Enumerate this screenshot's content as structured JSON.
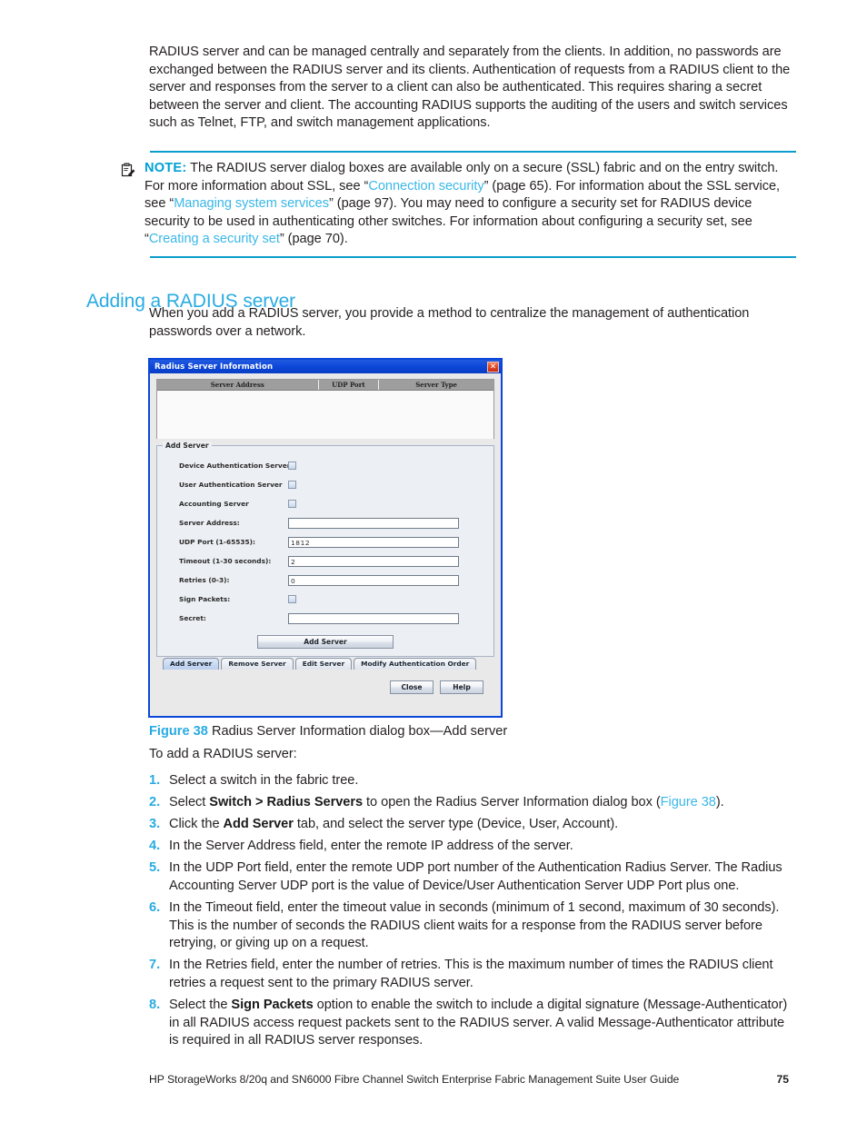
{
  "intro": {
    "paragraph": "RADIUS server and can be managed centrally and separately from the clients. In addition, no passwords are exchanged between the RADIUS server and its clients. Authentication of requests from a RADIUS client to the server and responses from the server to a client can also be authenticated. This requires sharing a secret between the server and client. The accounting RADIUS supports the auditing of the users and switch services such as Telnet, FTP, and switch management applications."
  },
  "note": {
    "icon": "note-clipboard-pencil-icon",
    "label": "NOTE:",
    "text_1": "The RADIUS server dialog boxes are available only on a secure (SSL) fabric and on the entry switch. For more information about SSL, see “",
    "link_1": "Connection security",
    "text_2": "” (page 65). For information about the SSL service, see “",
    "link_2": "Managing system services",
    "text_3": "” (page 97). You may need to configure a security set for RADIUS device security to be used in authenticating other switches. For information about configuring a security set, see “",
    "link_3": "Creating a security set",
    "text_4": "” (page 70)."
  },
  "section": {
    "heading": "Adding a RADIUS server",
    "intro": "When you add a RADIUS server, you provide a method to centralize the management of authentication passwords over a network."
  },
  "dialog": {
    "title": "Radius Server Information",
    "close_label": "✕",
    "table": {
      "headers": [
        "Server  Address",
        "UDP  Port",
        "Server  Type"
      ],
      "rows": []
    },
    "group": {
      "legend": "Add Server",
      "fields": [
        {
          "label": "Device Authentication Server",
          "type": "checkbox",
          "value": "",
          "checked": false
        },
        {
          "label": "User Authentication Server",
          "type": "checkbox",
          "value": "",
          "checked": false
        },
        {
          "label": "Accounting Server",
          "type": "checkbox",
          "value": "",
          "checked": false
        },
        {
          "label": "Server Address:",
          "type": "text",
          "value": ""
        },
        {
          "label": "UDP Port (1-65535):",
          "type": "text",
          "value": "1812"
        },
        {
          "label": "Timeout (1-30 seconds):",
          "type": "text",
          "value": "2"
        },
        {
          "label": "Retries (0-3):",
          "type": "text",
          "value": "0"
        },
        {
          "label": "Sign Packets:",
          "type": "checkbox",
          "value": "",
          "checked": false
        },
        {
          "label": "Secret:",
          "type": "text",
          "value": ""
        }
      ],
      "submit_label": "Add Server"
    },
    "tabs": [
      {
        "label": "Add Server",
        "selected": true
      },
      {
        "label": "Remove Server",
        "selected": false
      },
      {
        "label": "Edit Server",
        "selected": false
      },
      {
        "label": "Modify Authentication Order",
        "selected": false
      }
    ],
    "close_button": "Close",
    "help_button": "Help"
  },
  "figure": {
    "number": "Figure 38",
    "caption": "Radius Server Information dialog box—Add server"
  },
  "procedure": {
    "lead_in": "To add a RADIUS server:",
    "steps": [
      {
        "num": "1.",
        "html": "Select a switch in the fabric tree."
      },
      {
        "num": "2.",
        "html": "Select <b>Switch &gt; Radius Servers</b> to open the Radius Server Information dialog box (<span class=\"xref\">Figure 38</span>)."
      },
      {
        "num": "3.",
        "html": "Click the <b>Add Server</b> tab, and select the server type (Device, User, Account)."
      },
      {
        "num": "4.",
        "html": "In the Server Address field, enter the remote IP address of the server."
      },
      {
        "num": "5.",
        "html": "In the UDP Port field, enter the remote UDP port number of the Authentication Radius Server. The Radius Accounting Server UDP port is the value of Device/User Authentication Server UDP Port plus one."
      },
      {
        "num": "6.",
        "html": "In the Timeout field, enter the timeout value in seconds (minimum of 1 second, maximum of 30 seconds). This is the number of seconds the RADIUS client waits for a response from the RADIUS server before retrying, or giving up on a request."
      },
      {
        "num": "7.",
        "html": "In the Retries field, enter the number of retries. This is the maximum number of times the RADIUS client retries a request sent to the primary RADIUS server."
      },
      {
        "num": "8.",
        "html": "Select the <b>Sign Packets</b> option to enable the switch to include a digital signature (Message-Authenticator) in all RADIUS access request packets sent to the RADIUS server. A valid Message-Authenticator attribute is required in all RADIUS server responses."
      }
    ]
  },
  "page_footer": {
    "title": "HP StorageWorks 8/20q and SN6000 Fibre Channel Switch Enterprise Fabric Management Suite User Guide",
    "page_number": "75"
  },
  "colors": {
    "accent_cyan": "#29abe2",
    "rule_cyan": "#0b9dcc",
    "dialog_titlebar_blue": "#0b46d8",
    "close_red": "#c62f14"
  }
}
